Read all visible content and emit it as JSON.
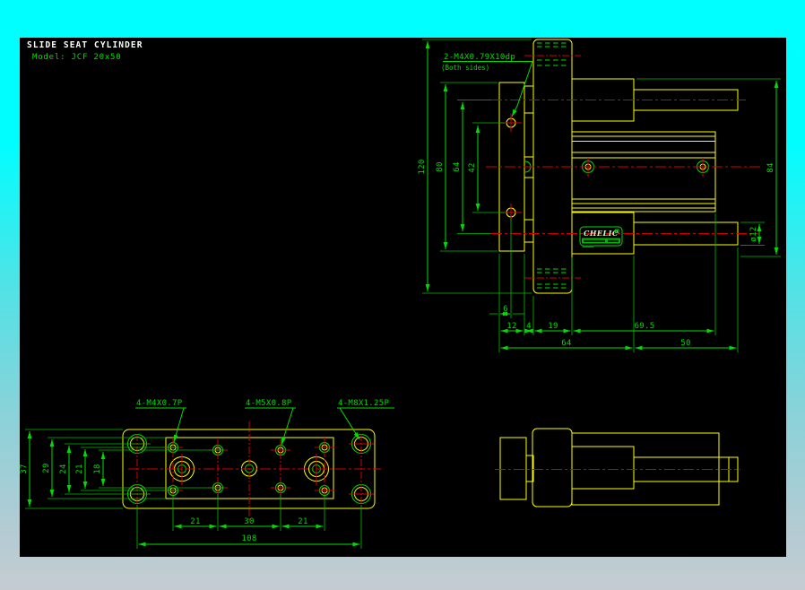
{
  "title": {
    "name": "SLIDE SEAT CYLINDER",
    "model": "Model: JCF 20x50"
  },
  "front_view": {
    "thread_note": "2-M4X0.79X10dp",
    "thread_note_sub": "(Both sides)",
    "logo_brand": "CHELIC",
    "dims": {
      "height_total": "120",
      "plate_height": "80",
      "rod_centers": "64",
      "hole_centers": "42",
      "body_height": "84",
      "rod_dia": "ø12",
      "hole_offset": "6",
      "plate_thk": "12",
      "gap": "4",
      "head_w": "19",
      "body_len": "69.5",
      "left_len": "64",
      "stroke_len": "50"
    }
  },
  "plan_view": {
    "notes": {
      "m4": "4-M4X0.7P",
      "m5": "4-M5X0.8P",
      "m8": "4-M8X1.25P"
    },
    "dims": {
      "w37": "37",
      "w29": "29",
      "w24": "24",
      "w21": "21",
      "w18": "18",
      "p21a": "21",
      "p30": "30",
      "p21b": "21",
      "len108": "108"
    }
  },
  "colors": {
    "background_top": "#00ffff",
    "background_bottom": "#c4ccd2",
    "canvas": "#000000",
    "geometry": "#ffff00",
    "dimensions": "#00dc00",
    "centerlines": "#d40000",
    "title_text": "#ffffff"
  }
}
